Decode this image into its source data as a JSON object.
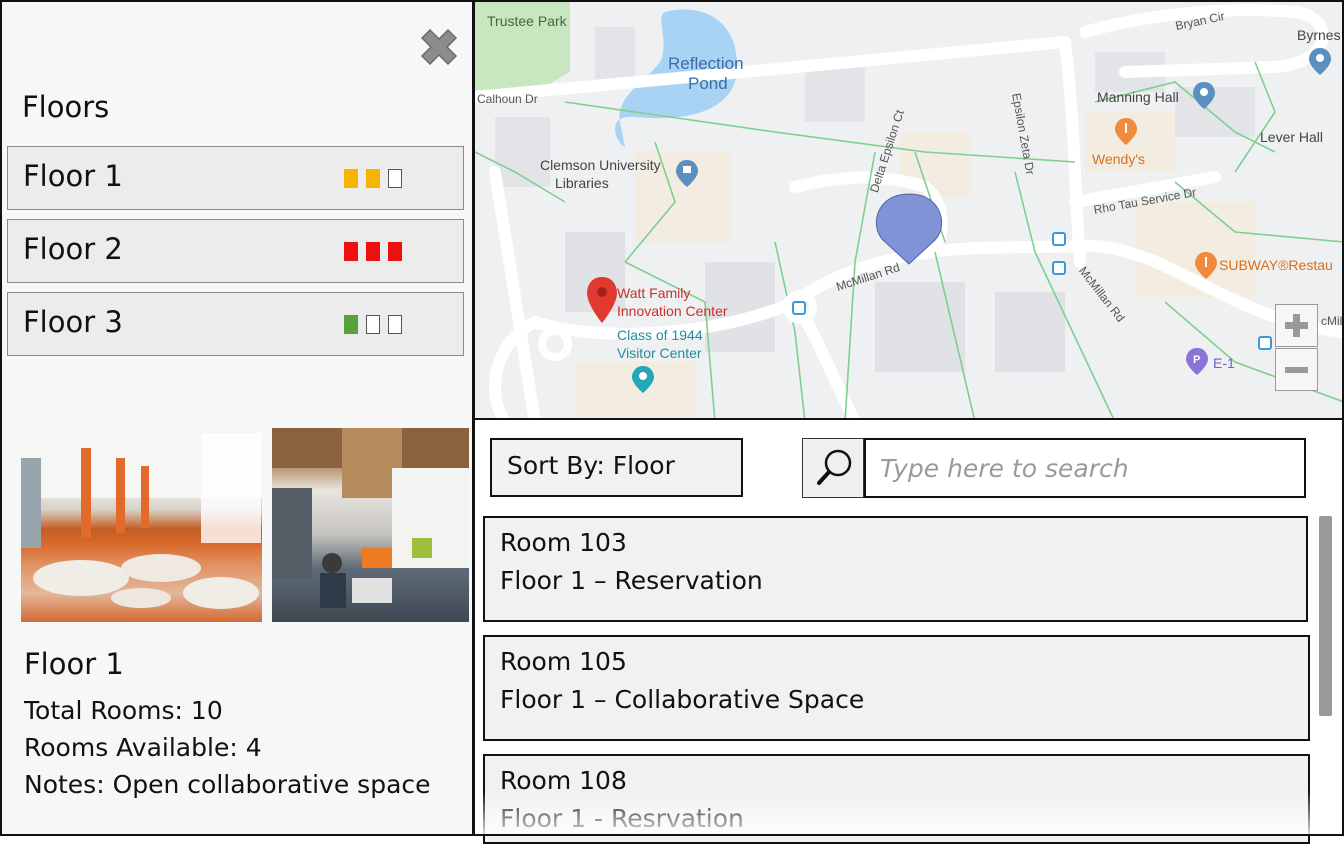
{
  "floors_panel": {
    "title": "Floors",
    "floors": [
      {
        "label": "Floor 1",
        "occupancy": [
          "#f5b400",
          "#f5b400",
          "empty"
        ]
      },
      {
        "label": "Floor 2",
        "occupancy": [
          "#ee1111",
          "#ee1111",
          "#ee1111"
        ]
      },
      {
        "label": "Floor 3",
        "occupancy": [
          "#5aa03c",
          "empty",
          "empty"
        ]
      }
    ]
  },
  "detail": {
    "title": "Floor 1",
    "total_rooms": "Total Rooms:  10",
    "rooms_available": "Rooms Available: 4",
    "notes": "Notes: Open collaborative space"
  },
  "map": {
    "labels": {
      "trustee_park": "Trustee Park",
      "reflection_pond_1": "Reflection",
      "reflection_pond_2": "Pond",
      "calhoun": "Calhoun Dr",
      "bryan": "Bryan Cir",
      "byrnes": "Byrnes",
      "manning": "Manning Hall",
      "lever": "Lever Hall",
      "wendys": "Wendy's",
      "epsilon_zeta": "Epsilon Zeta Dr",
      "delta_epsilon": "Delta Epsilon Ct",
      "rho_tau": "Rho Tau Service Dr",
      "libraries_1": "Clemson University",
      "libraries_2": "Libraries",
      "subway": "SUBWAY®Restau",
      "mcmillan_1": "McMillan Rd",
      "mcmillan_2": "McMillan Rd",
      "watt_1": "Watt Family",
      "watt_2": "Innovation Center",
      "visitor_1": "Class of 1944",
      "visitor_2": "Visitor Center",
      "e1": "E-1",
      "mcmil_edge": "cMil"
    },
    "zoom_in": "+",
    "zoom_out": "−"
  },
  "list": {
    "sort_label": "Sort By: Floor",
    "search_placeholder": "Type here to search",
    "rooms": [
      {
        "name": "Room 103",
        "desc": "Floor 1 – Reservation"
      },
      {
        "name": "Room 105",
        "desc": "Floor 1 – Collaborative Space"
      },
      {
        "name": "Room 108",
        "desc": "Floor 1 - Resrvation"
      }
    ]
  },
  "colors": {
    "yellow": "#f5b400",
    "red": "#ee1111",
    "green": "#5aa03c",
    "map_water": "#a9d3f5",
    "map_park": "#c8e6c0",
    "map_pin_blue": "#7f93d6"
  }
}
